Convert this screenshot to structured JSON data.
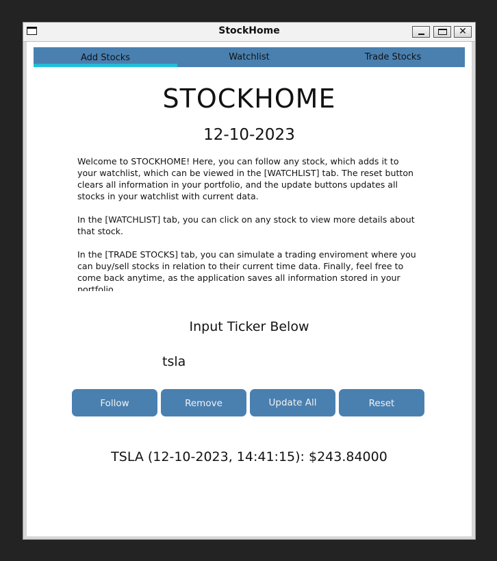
{
  "window": {
    "title": "StockHome"
  },
  "tabs": [
    {
      "label": "Add Stocks",
      "active": true
    },
    {
      "label": "Watchlist",
      "active": false
    },
    {
      "label": "Trade Stocks",
      "active": false
    }
  ],
  "header": {
    "title": "STOCKHOME",
    "date": "12-10-2023"
  },
  "description": {
    "paragraphs": [
      "Welcome to STOCKHOME! Here, you can follow any stock, which adds it to your watchlist, which can be viewed in the [WATCHLIST] tab. The reset button clears all information in your portfolio, and the update buttons updates all stocks in your watchlist with current data.",
      "In the [WATCHLIST] tab, you can click on any stock to view more details about that stock.",
      "In the [TRADE STOCKS] tab, you can simulate a trading enviroment where you can buy/sell stocks in relation to their current time data. Finally, feel free to come back anytime, as the application saves all information stored in your portfolio."
    ]
  },
  "ticker": {
    "label": "Input Ticker Below",
    "value": "tsla"
  },
  "buttons": {
    "follow": "Follow",
    "remove": "Remove",
    "update_all": "Update All",
    "reset": "Reset"
  },
  "result": {
    "text": "TSLA (12-10-2023, 14:41:15): $243.84000"
  },
  "colors": {
    "accent": "#4a80b0",
    "active_tab_underline": "#19c9d9",
    "background": "#ffffff"
  }
}
